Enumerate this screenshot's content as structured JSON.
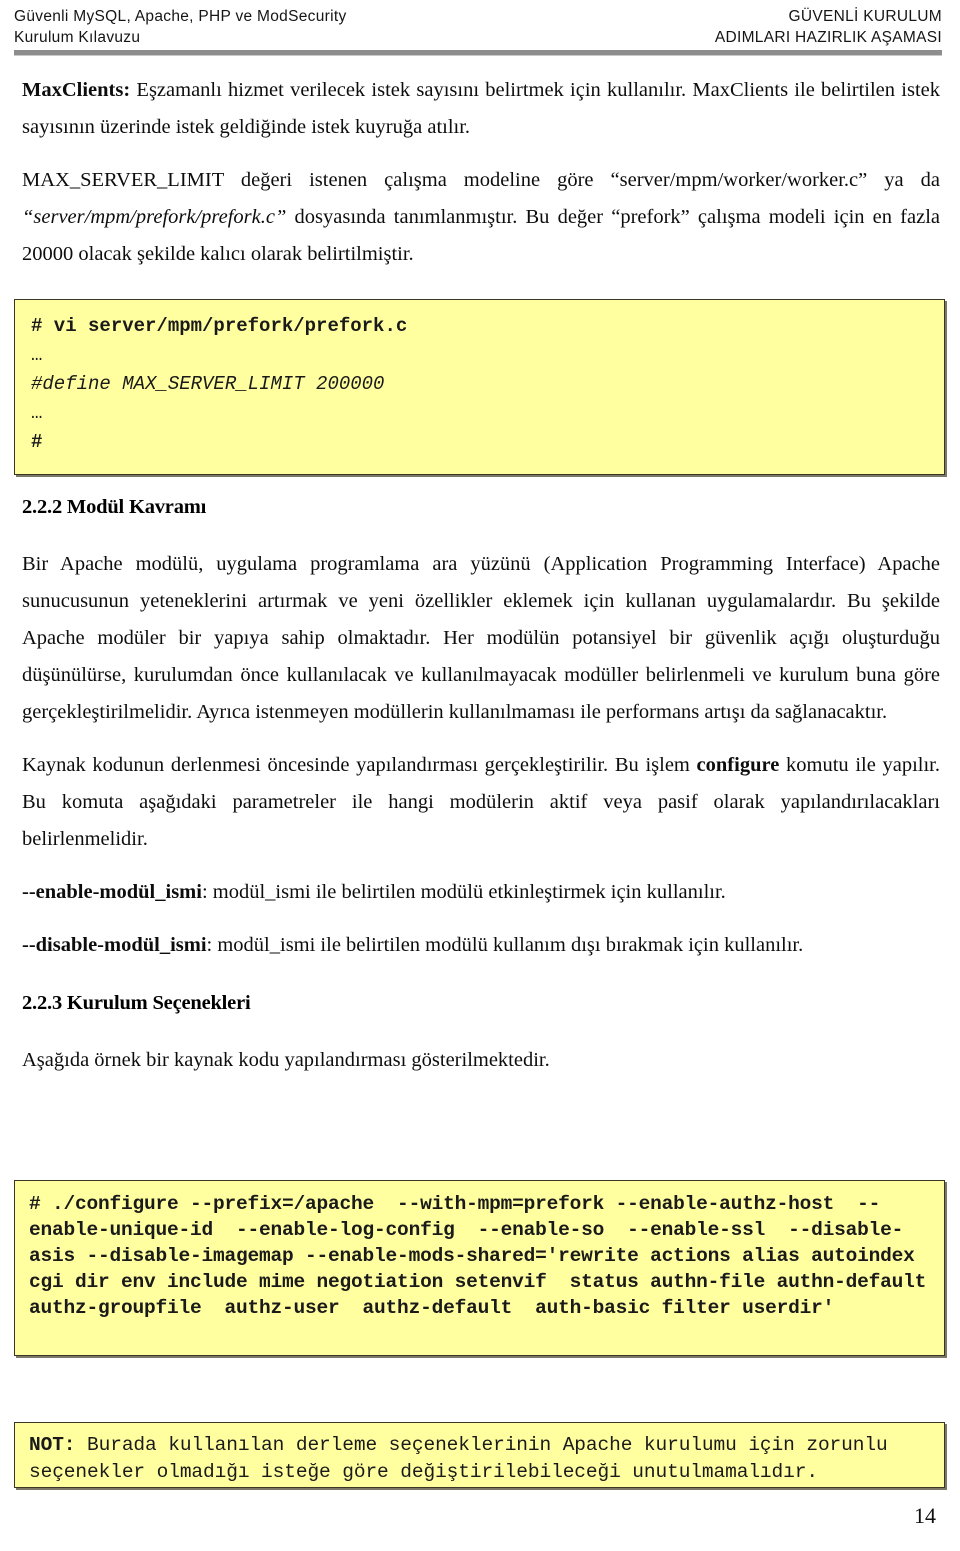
{
  "header": {
    "left_line1": "Güvenli MySQL, Apache, PHP ve ModSecurity",
    "left_line2": "Kurulum Kılavuzu",
    "right_line1": "GÜVENLİ KURULUM",
    "right_line2": "ADIMLARI HAZIRLIK AŞAMASI"
  },
  "body": {
    "para1_bold": "MaxClients:",
    "para1_rest": " Eşzamanlı hizmet verilecek istek sayısını belirtmek için kullanılır. MaxClients ile belirtilen istek sayısının üzerinde istek geldiğinde istek kuyruğa atılır.",
    "para2_a": "MAX_SERVER_LIMIT değeri istenen çalışma modeline göre “server/mpm/worker/worker.c” ya da ",
    "para2_italic": "“server/mpm/prefork/prefork.c”",
    "para2_b": " dosyasında tanımlanmıştır. Bu değer “prefork” çalışma modeli için en fazla 20000 olacak şekilde kalıcı olarak belirtilmiştir.",
    "heading_222": "2.2.2 Modül Kavramı",
    "para3": "Bir Apache modülü, uygulama programlama ara yüzünü (Application Programming Interface) Apache sunucusunun yeteneklerini artırmak ve yeni özellikler eklemek için kullanan uygulamalardır. Bu şekilde Apache modüler bir yapıya sahip olmaktadır. Her modülün potansiyel bir güvenlik açığı oluşturduğu düşünülürse, kurulumdan önce kullanılacak ve kullanılmayacak modüller belirlenmeli ve kurulum buna göre gerçekleştirilmelidir. Ayrıca istenmeyen modüllerin kullanılmaması ile performans artışı da sağlanacaktır.",
    "para4_a": "Kaynak kodunun derlenmesi öncesinde yapılandırması gerçekleştirilir. Bu işlem ",
    "para4_bold": "configure",
    "para4_b": " komutu ile yapılır. Bu komuta aşağıdaki parametreler ile hangi modülerin aktif veya pasif olarak yapılandırılacakları belirlenmelidir.",
    "enable_bold": "--enable-modül_ismi",
    "enable_rest": ": modül_ismi ile belirtilen modülü etkinleştirmek için kullanılır.",
    "disable_bold": "--disable-modül_ismi",
    "disable_rest": ": modül_ismi ile belirtilen modülü kullanım dışı bırakmak için kullanılır.",
    "heading_223": "2.2.3 Kurulum Seçenekleri",
    "para5": "Aşağıda örnek bir kaynak kodu yapılandırması gösterilmektedir."
  },
  "code_block_1": {
    "line1": "# vi server/mpm/prefork/prefork.c",
    "line2": "…",
    "line3": "#define MAX_SERVER_LIMIT 200000",
    "line4": "…",
    "line5": "#"
  },
  "code_block_2": {
    "text": "# ./configure --prefix=/apache  --with-mpm=prefork --enable-authz-host  --enable-unique-id  --enable-log-config  --enable-so  --enable-ssl  --disable-asis --disable-imagemap --enable-mods-shared='rewrite actions alias autoindex cgi dir env include mime negotiation setenvif  status authn-file authn-default  authz-groupfile  authz-user  authz-default  auth-basic filter userdir'"
  },
  "note_block": {
    "label": "NOT:",
    "text": " Burada kullanılan derleme seçeneklerinin Apache kurulumu için zorunlu seçenekler olmadığı isteğe göre değiştirilebileceği unutulmamalıdır."
  },
  "footer": {
    "page_number": "14"
  },
  "colors": {
    "code_background": "#ffffa0",
    "code_border": "#3a3524",
    "header_rule": "#8d8d8d",
    "text": "#0d0d0d"
  }
}
